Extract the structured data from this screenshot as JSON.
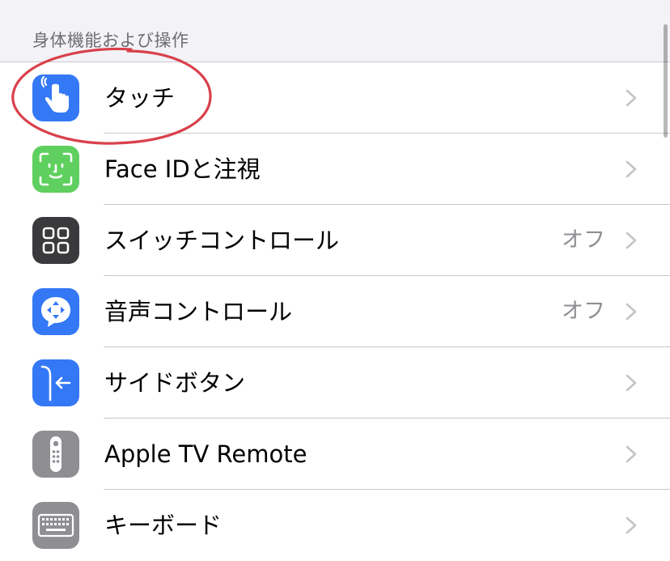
{
  "section": {
    "header": "身体機能および操作"
  },
  "colors": {
    "blue": "#3478f6",
    "green": "#5fd05f",
    "dark": "#3a3a3c",
    "gray": "#8e8e93",
    "annotation": "#d9414b"
  },
  "rows": [
    {
      "label": "タッチ",
      "value": "",
      "icon": "hand-pointer-icon",
      "icon_bg": "#3478f6"
    },
    {
      "label": "Face IDと注視",
      "value": "",
      "icon": "face-id-icon",
      "icon_bg": "#5fd05f"
    },
    {
      "label": "スイッチコントロール",
      "value": "オフ",
      "icon": "switch-grid-icon",
      "icon_bg": "#3a3a3c"
    },
    {
      "label": "音声コントロール",
      "value": "オフ",
      "icon": "voice-control-icon",
      "icon_bg": "#3478f6"
    },
    {
      "label": "サイドボタン",
      "value": "",
      "icon": "side-button-icon",
      "icon_bg": "#3478f6"
    },
    {
      "label": "Apple TV Remote",
      "value": "",
      "icon": "remote-icon",
      "icon_bg": "#8e8e93"
    },
    {
      "label": "キーボード",
      "value": "",
      "icon": "keyboard-icon",
      "icon_bg": "#8e8e93"
    }
  ]
}
